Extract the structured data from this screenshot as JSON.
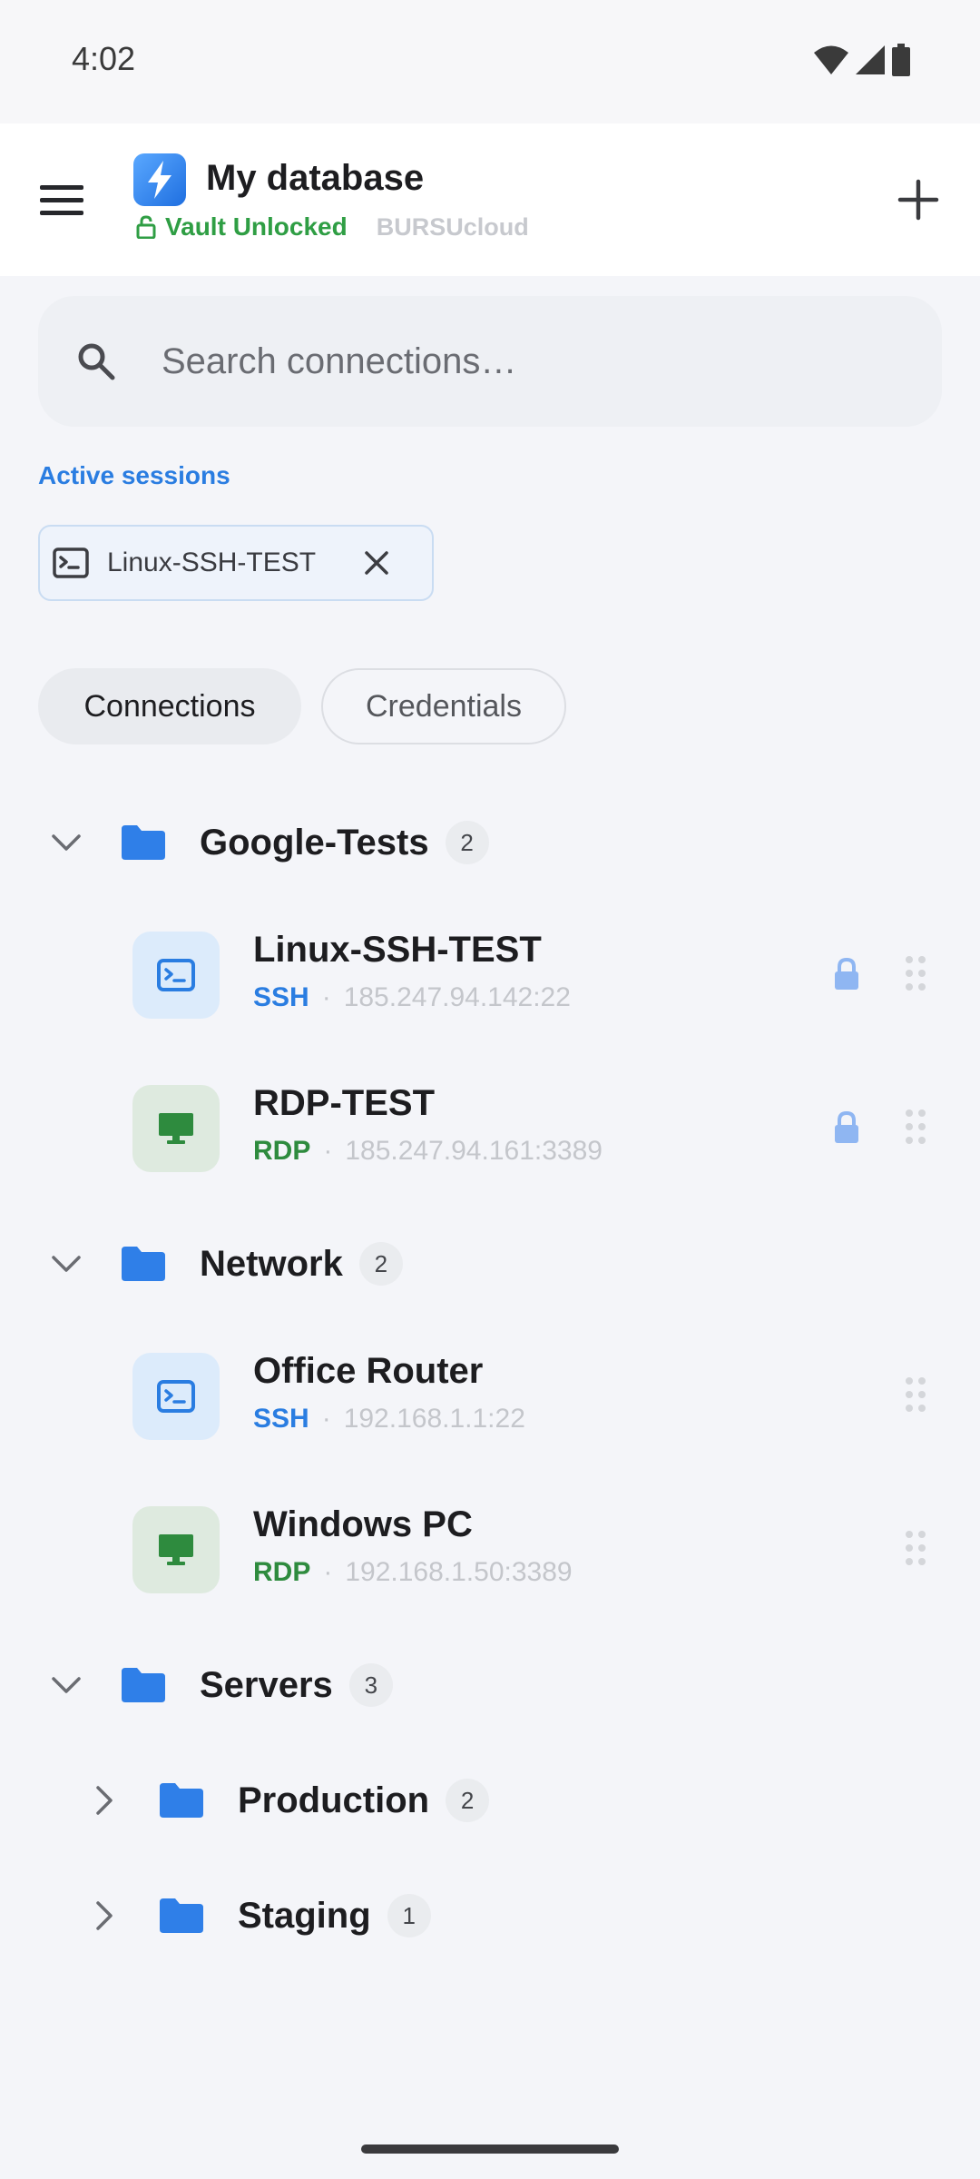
{
  "status_bar": {
    "time": "4:02"
  },
  "app_bar": {
    "title": "My database",
    "vault_status": "Vault Unlocked",
    "cloud_name": "BURSUcloud"
  },
  "search": {
    "placeholder": "Search connections…"
  },
  "active_sessions": {
    "label": "Active sessions",
    "sessions": [
      {
        "label": "Linux-SSH-TEST"
      }
    ]
  },
  "tabs": [
    {
      "label": "Connections",
      "selected": true
    },
    {
      "label": "Credentials",
      "selected": false
    }
  ],
  "tree": {
    "folders": [
      {
        "name": "Google-Tests",
        "count": "2",
        "expanded": true,
        "connections": [
          {
            "name": "Linux-SSH-TEST",
            "protocol": "SSH",
            "address": "185.247.94.142:22",
            "locked": true
          },
          {
            "name": "RDP-TEST",
            "protocol": "RDP",
            "address": "185.247.94.161:3389",
            "locked": true
          }
        ]
      },
      {
        "name": "Network",
        "count": "2",
        "expanded": true,
        "connections": [
          {
            "name": "Office Router",
            "protocol": "SSH",
            "address": "192.168.1.1:22",
            "locked": false
          },
          {
            "name": "Windows PC",
            "protocol": "RDP",
            "address": "192.168.1.50:3389",
            "locked": false
          }
        ]
      },
      {
        "name": "Servers",
        "count": "3",
        "expanded": true,
        "subfolders": [
          {
            "name": "Production",
            "count": "2",
            "expanded": false
          },
          {
            "name": "Staging",
            "count": "1",
            "expanded": false
          }
        ]
      }
    ]
  },
  "colors": {
    "accent": "#2a7de1",
    "vault_green": "#2f9e44",
    "rdp_green": "#2e8b3e",
    "folder_blue": "#2f7fe8"
  },
  "icons": {
    "menu": "hamburger-menu-icon",
    "add": "plus-icon",
    "search": "search-icon",
    "ssh": "terminal-icon",
    "rdp": "monitor-icon",
    "folder": "folder-icon",
    "lock": "lock-icon",
    "drag": "drag-handle-icon"
  }
}
